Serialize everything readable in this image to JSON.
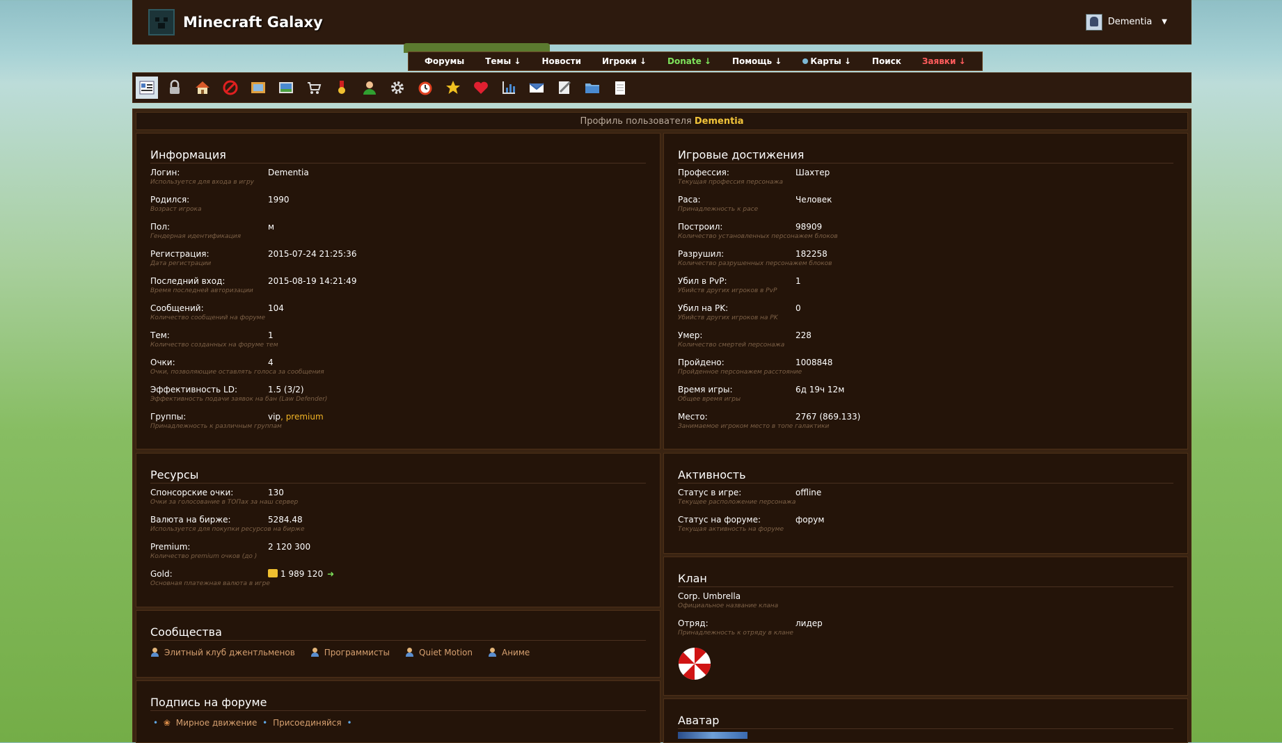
{
  "site": {
    "title": "Minecraft Galaxy"
  },
  "user": {
    "name": "Dementia",
    "caret": "▼"
  },
  "menu": [
    {
      "label": "Форумы",
      "style": "normal"
    },
    {
      "label": "Темы ↓",
      "style": "normal"
    },
    {
      "label": "Новости",
      "style": "normal"
    },
    {
      "label": "Игроки ↓",
      "style": "normal"
    },
    {
      "label": "Donate ↓",
      "style": "green"
    },
    {
      "label": "Помощь ↓",
      "style": "normal"
    },
    {
      "label": "Карты ↓",
      "style": "normal",
      "dot": true
    },
    {
      "label": "Поиск",
      "style": "normal"
    },
    {
      "label": "Заявки ↓",
      "style": "red"
    }
  ],
  "toolbar": [
    {
      "icon": "profile-card-icon",
      "active": true
    },
    {
      "icon": "lock-icon"
    },
    {
      "icon": "home-icon"
    },
    {
      "icon": "ban-icon"
    },
    {
      "icon": "picture-frame-icon"
    },
    {
      "icon": "image-icon"
    },
    {
      "icon": "cart-icon"
    },
    {
      "icon": "medal-icon"
    },
    {
      "icon": "user-icon"
    },
    {
      "icon": "gear-icon"
    },
    {
      "icon": "clock-icon"
    },
    {
      "icon": "star-icon"
    },
    {
      "icon": "heart-icon"
    },
    {
      "icon": "bar-chart-icon"
    },
    {
      "icon": "mail-icon"
    },
    {
      "icon": "edit-icon"
    },
    {
      "icon": "folder-icon"
    },
    {
      "icon": "notepad-icon"
    }
  ],
  "profile_header": {
    "prefix": "Профиль пользователя",
    "name": "Dementia"
  },
  "info": {
    "title": "Информация",
    "rows": [
      {
        "label": "Логин:",
        "value": "Dementia",
        "desc": "Используется для входа в игру"
      },
      {
        "label": "Родился:",
        "value": "1990",
        "desc": "Возраст игрока"
      },
      {
        "label": "Пол:",
        "value": "м",
        "desc": "Гендерная идентификация"
      },
      {
        "label": "Регистрация:",
        "value": "2015-07-24 21:25:36",
        "desc": "Дата регистрации"
      },
      {
        "label": "Последний вход:",
        "value": "2015-08-19 14:21:49",
        "desc": "Время последней авторизации"
      },
      {
        "label": "Сообщений:",
        "value": "104",
        "desc": "Количество сообщений на форуме"
      },
      {
        "label": "Тем:",
        "value": "1",
        "desc": "Количество созданных на форуме тем"
      },
      {
        "label": "Очки:",
        "value": "4",
        "desc": "Очки, позволяющие оставлять голоса за сообщения"
      },
      {
        "label": "Эффективность LD:",
        "value": "1.5",
        "value_extra": " (3/2)",
        "desc": "Эффективность подачи заявок на бан (Law Defender)"
      },
      {
        "label": "Группы:",
        "value": "vip",
        "value_extra": ", premium",
        "desc": "Принадлежность к различным группам"
      }
    ]
  },
  "achievements": {
    "title": "Игровые достижения",
    "rows": [
      {
        "label": "Профессия:",
        "value": "Шахтер",
        "desc": "Текущая профессия персонажа"
      },
      {
        "label": "Раса:",
        "value": "Человек",
        "desc": "Принадлежность к расе"
      },
      {
        "label": "Построил:",
        "value": "98909",
        "desc": "Количество установленных персонажем блоков"
      },
      {
        "label": "Разрушил:",
        "value": "182258",
        "desc": "Количество разрушенных персонажем блоков"
      },
      {
        "label": "Убил в PvP:",
        "value": "1",
        "desc": "Убийств других игроков в PvP"
      },
      {
        "label": "Убил на PK:",
        "value": "0",
        "desc": "Убийств других игроков на PK"
      },
      {
        "label": "Умер:",
        "value": "228",
        "desc": "Количество смертей персонажа"
      },
      {
        "label": "Пройдено:",
        "value": "1008848",
        "desc": "Пройденное персонажем расстояние"
      },
      {
        "label": "Время игры:",
        "value": "6д 19ч 12м",
        "desc": "Общее время игры"
      },
      {
        "label": "Место:",
        "value": "2767",
        "value_extra": " (869.133)",
        "desc": "Занимаемое игроком место в топе галактики"
      }
    ]
  },
  "resources": {
    "title": "Ресурсы",
    "rows": [
      {
        "label": "Спонсорские очки",
        "value": "130",
        "desc": "Очки за голосование в ТОПах за наш сервер"
      },
      {
        "label": "Валюта на бирже",
        "value": "5284.48",
        "desc": "Используется для покупки ресурсов на бирже"
      },
      {
        "label": "Premium",
        "value": "2 120 300",
        "desc": "Количество premium очков (до )"
      },
      {
        "label": "Gold",
        "value": "1 989 120",
        "desc": "Основная платежная валюта в игре"
      }
    ]
  },
  "activity": {
    "title": "Активность",
    "rows": [
      {
        "label": "Статус в игре:",
        "value": "offline",
        "desc": "Текущее расположение персонажа"
      },
      {
        "label": "Статус на форуме:",
        "value": "форум",
        "desc": "Текущая активность на форуме"
      }
    ]
  },
  "communities": {
    "title": "Сообщества",
    "items": [
      "Элитный клуб джентльменов",
      "Программисты",
      "Quiet Motion",
      "Аниме"
    ]
  },
  "clan": {
    "title": "Клан",
    "name": "Corp. Umbrella",
    "name_desc": "Официальное название клана",
    "squad_label": "Отряд:",
    "squad_value": "лидер",
    "squad_desc": "Принадлежность к отряду в клане"
  },
  "signature": {
    "title": "Подпись на форуме",
    "b1": "•",
    "flower": "❀",
    "link1": "Мирное движение",
    "b2": "•",
    "link2": "Присоединяйся",
    "b3": "•"
  },
  "avatar": {
    "title": "Аватар"
  },
  "colors": {
    "accent": "#f2c43a",
    "link": "#76b6e6",
    "green": "#7ee35c",
    "red": "#ff5050",
    "bg": "#241409"
  }
}
